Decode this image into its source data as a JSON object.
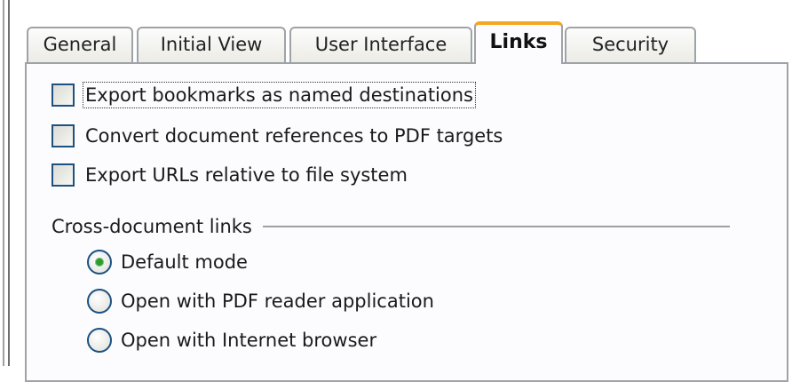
{
  "tabs": [
    {
      "label": "General",
      "active": false
    },
    {
      "label": "Initial View",
      "active": false
    },
    {
      "label": "User Interface",
      "active": false
    },
    {
      "label": "Links",
      "active": true
    },
    {
      "label": "Security",
      "active": false
    }
  ],
  "links": {
    "checkboxes": [
      {
        "label": "Export bookmarks as named destinations",
        "mnemonic": "E",
        "checked": false,
        "focused": true
      },
      {
        "label": "Convert document references to PDF targets",
        "mnemonic": "C",
        "checked": false,
        "focused": false
      },
      {
        "label": "Export URLs relative to file system",
        "mnemonic": "U",
        "checked": false,
        "focused": false
      }
    ],
    "cross_document": {
      "group_label": "Cross-document links",
      "options": [
        {
          "label": "Default mode",
          "mnemonic": "D",
          "selected": true
        },
        {
          "label": "Open with PDF reader application",
          "mnemonic": "O",
          "selected": false
        },
        {
          "label": "Open with Internet browser",
          "mnemonic": "w",
          "selected": false
        }
      ]
    }
  },
  "colors": {
    "active_tab_accent": "#f5a623",
    "control_border": "#1c5180",
    "radio_selected": "#2f9a2f"
  }
}
